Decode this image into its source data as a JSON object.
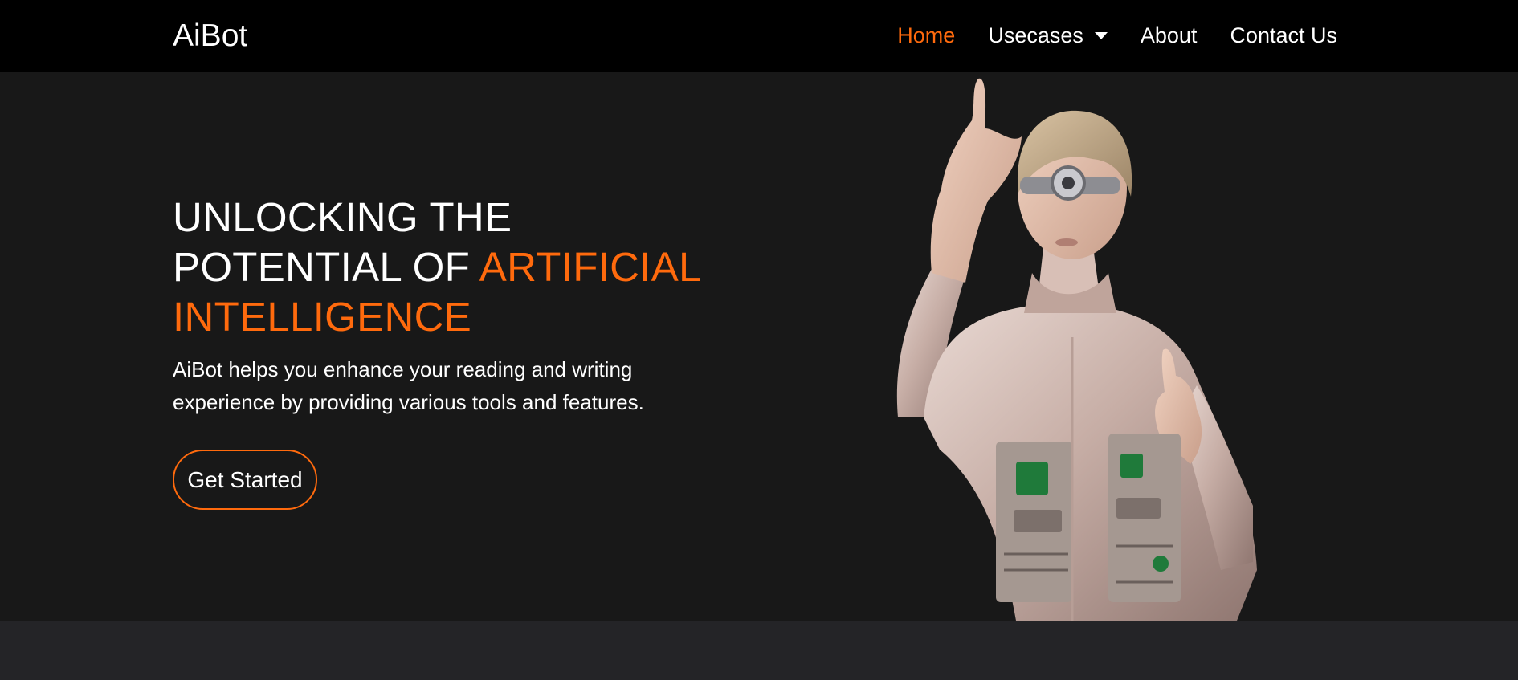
{
  "nav": {
    "brand": "AiBot",
    "links": [
      {
        "label": "Home",
        "active": true
      },
      {
        "label": "Usecases",
        "dropdown": true
      },
      {
        "label": "About"
      },
      {
        "label": "Contact Us"
      }
    ]
  },
  "hero": {
    "headline_part1": "UNLOCKING THE POTENTIAL OF ",
    "headline_accent": "ARTIFICIAL INTELLIGENCE",
    "subtext": "AiBot helps you enhance your reading and writing experience by providing various tools and features.",
    "cta_label": "Get Started",
    "image_alt": "woman-in-silver-cyborg-suit-pointing-up"
  },
  "colors": {
    "accent": "#ff6a0d",
    "navbar_bg": "#000000",
    "hero_bg": "#181818",
    "page_bg": "#242427"
  }
}
